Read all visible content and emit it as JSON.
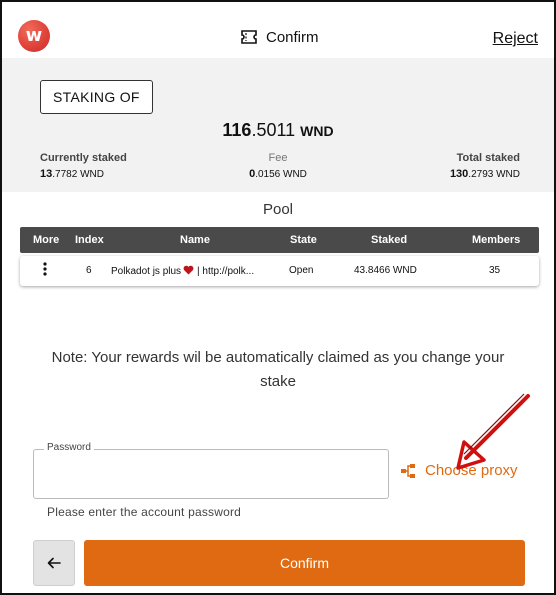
{
  "header": {
    "title": "Confirm",
    "reject_label": "Reject",
    "logo_letter": "w",
    "icons": {
      "logo": "wallet-logo-icon",
      "title": "ticket-icon"
    }
  },
  "summary": {
    "badge": "STAKING OF",
    "amount_int": "116",
    "amount_dec": ".5011",
    "amount_unit": "WND",
    "currently_staked": {
      "label": "Currently staked",
      "int": "13",
      "dec": ".7782",
      "unit": "WND"
    },
    "fee": {
      "label": "Fee",
      "int": "0",
      "dec": ".0156",
      "unit": "WND"
    },
    "total_staked": {
      "label": "Total staked",
      "int": "130",
      "dec": ".2793",
      "unit": "WND"
    }
  },
  "pool": {
    "title": "Pool",
    "columns": [
      "More",
      "Index",
      "Name",
      "State",
      "Staked",
      "Members"
    ],
    "row": {
      "index": "6",
      "name_part1": "Polkadot js plus",
      "name_part2": "| http://polk...",
      "state": "Open",
      "staked": "43.8466 WND",
      "members": "35"
    }
  },
  "note": "Note: Your rewards wil be automatically claimed as you change your stake",
  "password": {
    "label": "Password",
    "value": "",
    "help": "Please enter the account password"
  },
  "proxy": {
    "label": "Choose proxy",
    "icon": "proxy-tree-icon"
  },
  "actions": {
    "confirm_label": "Confirm",
    "back_icon": "arrow-left-icon"
  },
  "colors": {
    "accent": "#e06a12",
    "annotation_arrow": "#d10f0f",
    "table_header": "#4a4a4a"
  }
}
